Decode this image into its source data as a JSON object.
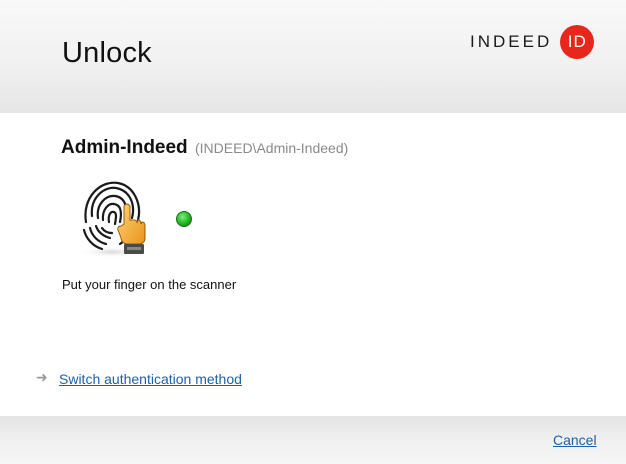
{
  "header": {
    "title": "Unlock",
    "brand_text": "INDEED",
    "brand_badge": "ID",
    "brand_color": "#e8271c"
  },
  "user": {
    "name": "Admin-Indeed",
    "account": "(INDEED\\Admin-Indeed)"
  },
  "scanner": {
    "icon": "fingerprint-scanner-icon",
    "status_icon": "green-status-dot-icon",
    "status_color": "#22b322",
    "instruction": "Put your finger on the scanner"
  },
  "actions": {
    "switch_arrow": "➜",
    "switch_label": "Switch authentication method",
    "cancel_label": "Cancel",
    "link_color": "#1f5fa8"
  }
}
